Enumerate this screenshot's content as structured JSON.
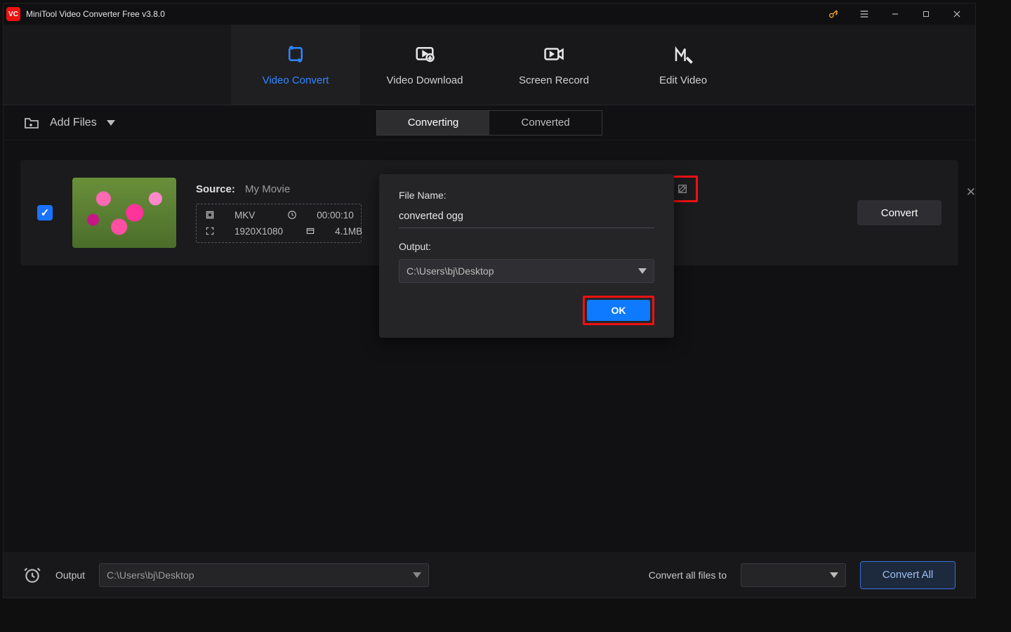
{
  "titlebar": {
    "app_logo_text": "VC",
    "title": "MiniTool Video Converter Free v3.8.0"
  },
  "main_tabs": [
    {
      "label": "Video Convert",
      "active": true,
      "name": "video-convert"
    },
    {
      "label": "Video Download",
      "active": false,
      "name": "video-download"
    },
    {
      "label": "Screen Record",
      "active": false,
      "name": "screen-record"
    },
    {
      "label": "Edit Video",
      "active": false,
      "name": "edit-video"
    }
  ],
  "subbar": {
    "add_files_label": "Add Files",
    "segments": {
      "converting": "Converting",
      "converted": "Converted",
      "active": "converting"
    }
  },
  "file": {
    "source_label": "Source:",
    "source_name": "My Movie",
    "format": "MKV",
    "duration": "00:00:10",
    "resolution": "1920X1080",
    "size": "4.1MB",
    "convert_btn": "Convert",
    "checked": true
  },
  "popup": {
    "filename_label": "File Name:",
    "filename_value": "converted ogg",
    "output_label": "Output:",
    "output_path": "C:\\Users\\bj\\Desktop",
    "ok_label": "OK"
  },
  "bottom": {
    "output_label": "Output",
    "output_path": "C:\\Users\\bj\\Desktop",
    "convert_to_label": "Convert all files to",
    "convert_all_label": "Convert All"
  }
}
